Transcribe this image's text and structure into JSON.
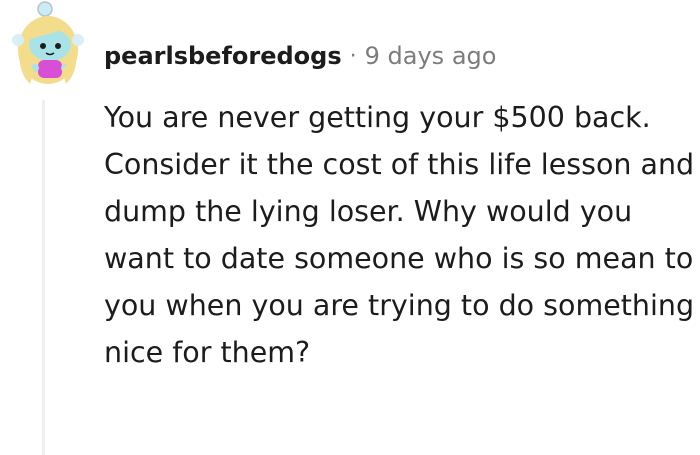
{
  "comment": {
    "author": "pearlsbeforedogs",
    "separator": "·",
    "timestamp": "9 days ago",
    "body": "You are never getting your $500 back. Consider it the cost of this life lesson and dump the lying loser. Why would you want to date someone who is so mean to you when you are trying to do something nice for them?"
  },
  "avatar": {
    "icon": "snoo-avatar-icon",
    "colors": {
      "hair": "#f3dc8c",
      "skin": "#a9e3e8",
      "shirt": "#d84fd6",
      "antenna": "#c9edf5"
    }
  },
  "colors": {
    "author_text": "#1c1c1c",
    "meta_text": "#7c7c7c",
    "thread_line": "#edeff1"
  }
}
